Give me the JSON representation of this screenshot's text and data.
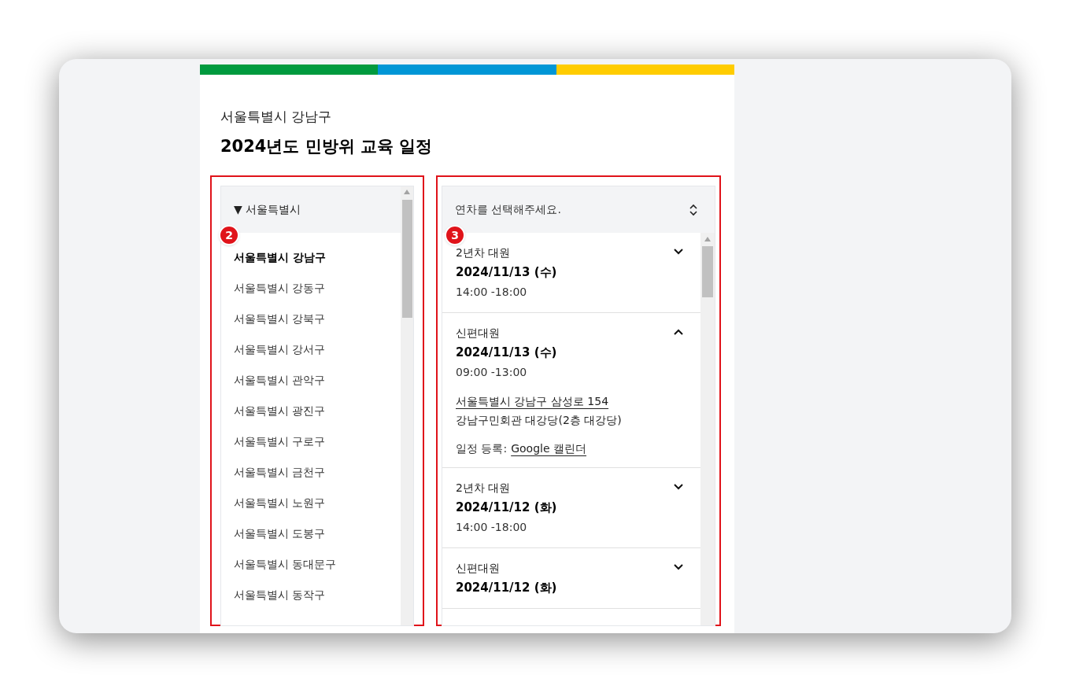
{
  "color_bar": [
    {
      "color": "#009a3e"
    },
    {
      "color": "#0096d6"
    },
    {
      "color": "#ffcc00"
    }
  ],
  "subtitle": "서울특별시 강남구",
  "title": "2024년도 민방위 교육 일정",
  "region_list": {
    "badge": "2",
    "header": "▼ 서울특별시",
    "items": [
      {
        "label": "서울특별시 강남구",
        "selected": true
      },
      {
        "label": "서울특별시 강동구",
        "selected": false
      },
      {
        "label": "서울특별시 강북구",
        "selected": false
      },
      {
        "label": "서울특별시 강서구",
        "selected": false
      },
      {
        "label": "서울특별시 관악구",
        "selected": false
      },
      {
        "label": "서울특별시 광진구",
        "selected": false
      },
      {
        "label": "서울특별시 구로구",
        "selected": false
      },
      {
        "label": "서울특별시 금천구",
        "selected": false
      },
      {
        "label": "서울특별시 노원구",
        "selected": false
      },
      {
        "label": "서울특별시 도봉구",
        "selected": false
      },
      {
        "label": "서울특별시 동대문구",
        "selected": false
      },
      {
        "label": "서울특별시 동작구",
        "selected": false
      }
    ]
  },
  "schedule": {
    "badge": "3",
    "select": {
      "placeholder": "연차를 선택해주세요."
    },
    "sessions": [
      {
        "group": "2년차 대원",
        "date": "2024/11/13 (수)",
        "time": "14:00 -18:00",
        "expanded": false
      },
      {
        "group": "신편대원",
        "date": "2024/11/13 (수)",
        "time": "09:00 -13:00",
        "expanded": true,
        "address": "서울특별시 강남구 삼성로 154",
        "venue": "강남구민회관 대강당(2층 대강당)",
        "calendar_label": "일정 등록:",
        "calendar_link": "Google 캘린더"
      },
      {
        "group": "2년차 대원",
        "date": "2024/11/12 (화)",
        "time": "14:00 -18:00",
        "expanded": false
      },
      {
        "group": "신편대원",
        "date": "2024/11/12 (화)",
        "expanded": false
      }
    ]
  }
}
